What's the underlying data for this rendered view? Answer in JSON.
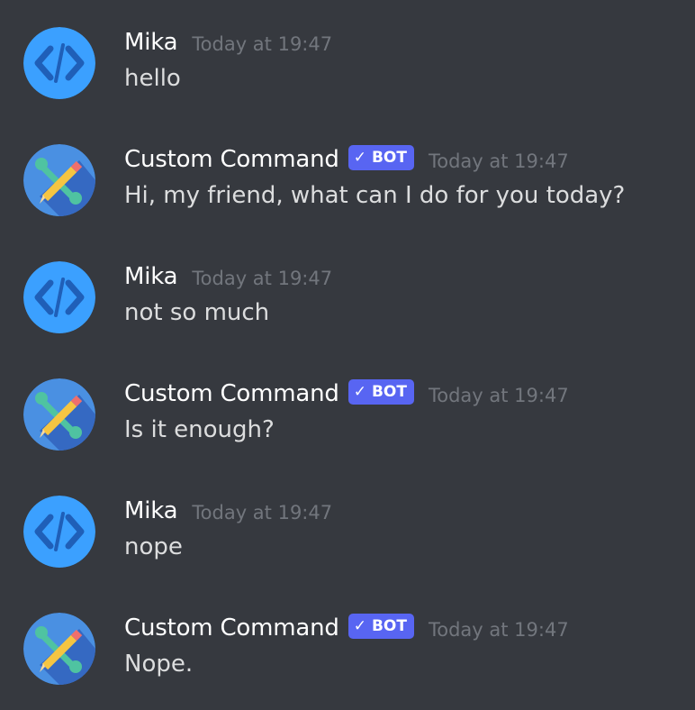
{
  "colors": {
    "background": "#36393f",
    "username": "#ffffff",
    "message_text": "#dcddde",
    "timestamp": "#72767d",
    "bot_tag": "#5865f2",
    "mika_avatar": "#3ba0ff",
    "bot_avatar": "#4a90e2"
  },
  "messages": [
    {
      "author": "Mika",
      "timestamp": "Today at 19:47",
      "content": "hello",
      "avatar_icon": "code-brackets-icon"
    },
    {
      "author": "Custom Command",
      "bot_tag": "BOT",
      "bot_check": "✓",
      "timestamp": "Today at 19:47",
      "content": "Hi, my friend, what can I do for you today?",
      "avatar_icon": "pencil-wrench-icon"
    },
    {
      "author": "Mika",
      "timestamp": "Today at 19:47",
      "content": "not so much",
      "avatar_icon": "code-brackets-icon"
    },
    {
      "author": "Custom Command",
      "bot_tag": "BOT",
      "bot_check": "✓",
      "timestamp": "Today at 19:47",
      "content": "Is it enough?",
      "avatar_icon": "pencil-wrench-icon"
    },
    {
      "author": "Mika",
      "timestamp": "Today at 19:47",
      "content": "nope",
      "avatar_icon": "code-brackets-icon"
    },
    {
      "author": "Custom Command",
      "bot_tag": "BOT",
      "bot_check": "✓",
      "timestamp": "Today at 19:47",
      "content": "Nope.",
      "avatar_icon": "pencil-wrench-icon"
    }
  ]
}
